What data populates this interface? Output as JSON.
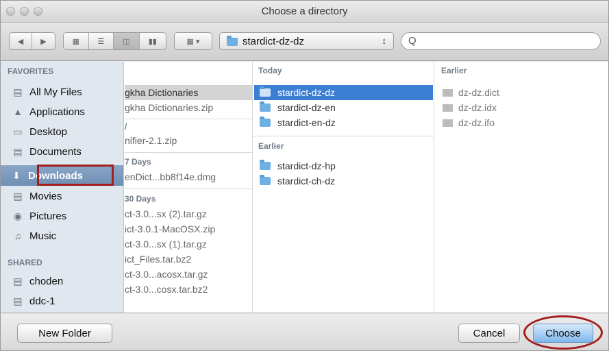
{
  "window": {
    "title": "Choose a directory"
  },
  "toolbar": {
    "path_label": "stardict-dz-dz",
    "popup_arrows": "↕",
    "search_placeholder": "",
    "search_glyph": "Q"
  },
  "sidebar": {
    "favorites_header": "FAVORITES",
    "shared_header": "SHARED",
    "favorites": [
      {
        "label": "All My Files",
        "icon": "all-files-icon"
      },
      {
        "label": "Applications",
        "icon": "applications-icon"
      },
      {
        "label": "Desktop",
        "icon": "desktop-icon"
      },
      {
        "label": "Documents",
        "icon": "documents-icon"
      },
      {
        "label": "Downloads",
        "icon": "downloads-icon",
        "selected": true
      },
      {
        "label": "Movies",
        "icon": "movies-icon"
      },
      {
        "label": "Pictures",
        "icon": "pictures-icon"
      },
      {
        "label": "Music",
        "icon": "music-icon"
      }
    ],
    "shared": [
      {
        "label": "choden",
        "icon": "computer-icon"
      },
      {
        "label": "ddc-1",
        "icon": "computer-icon"
      }
    ]
  },
  "col1": {
    "items": [
      {
        "text": "gkha Dictionaries",
        "type": "folder",
        "selected": true
      },
      {
        "text": "gkha Dictionaries.zip",
        "type": "file"
      },
      {
        "text": "/",
        "type": "header"
      },
      {
        "text": "nifier-2.1.zip",
        "type": "file"
      },
      {
        "text": "7 Days",
        "type": "header"
      },
      {
        "text": "enDict...bb8f14e.dmg",
        "type": "file"
      },
      {
        "text": "30 Days",
        "type": "header"
      },
      {
        "text": "ct-3.0...sx (2).tar.gz",
        "type": "file"
      },
      {
        "text": "ict-3.0.1-MacOSX.zip",
        "type": "file"
      },
      {
        "text": "ct-3.0...sx (1).tar.gz",
        "type": "file"
      },
      {
        "text": "ict_Files.tar.bz2",
        "type": "file"
      },
      {
        "text": "ct-3.0...acosx.tar.gz",
        "type": "file"
      },
      {
        "text": "ct-3.0...cosx.tar.bz2",
        "type": "file"
      }
    ]
  },
  "col2": {
    "today_header": "Today",
    "earlier_header": "Earlier",
    "today": [
      "stardict-dz-dz",
      "stardict-dz-en",
      "stardict-en-dz"
    ],
    "earlier": [
      "stardict-dz-hp",
      "stardict-ch-dz"
    ],
    "selected": "stardict-dz-dz"
  },
  "col3": {
    "header": "Earlier",
    "files": [
      "dz-dz.dict",
      "dz-dz.idx",
      "dz-dz.ifo"
    ]
  },
  "buttons": {
    "new_folder": "New Folder",
    "cancel": "Cancel",
    "choose": "Choose"
  },
  "colors": {
    "selection_blue": "#3b7fd4",
    "annotation_red": "#a31e1e",
    "folder_blue": "#6fb0e3"
  }
}
